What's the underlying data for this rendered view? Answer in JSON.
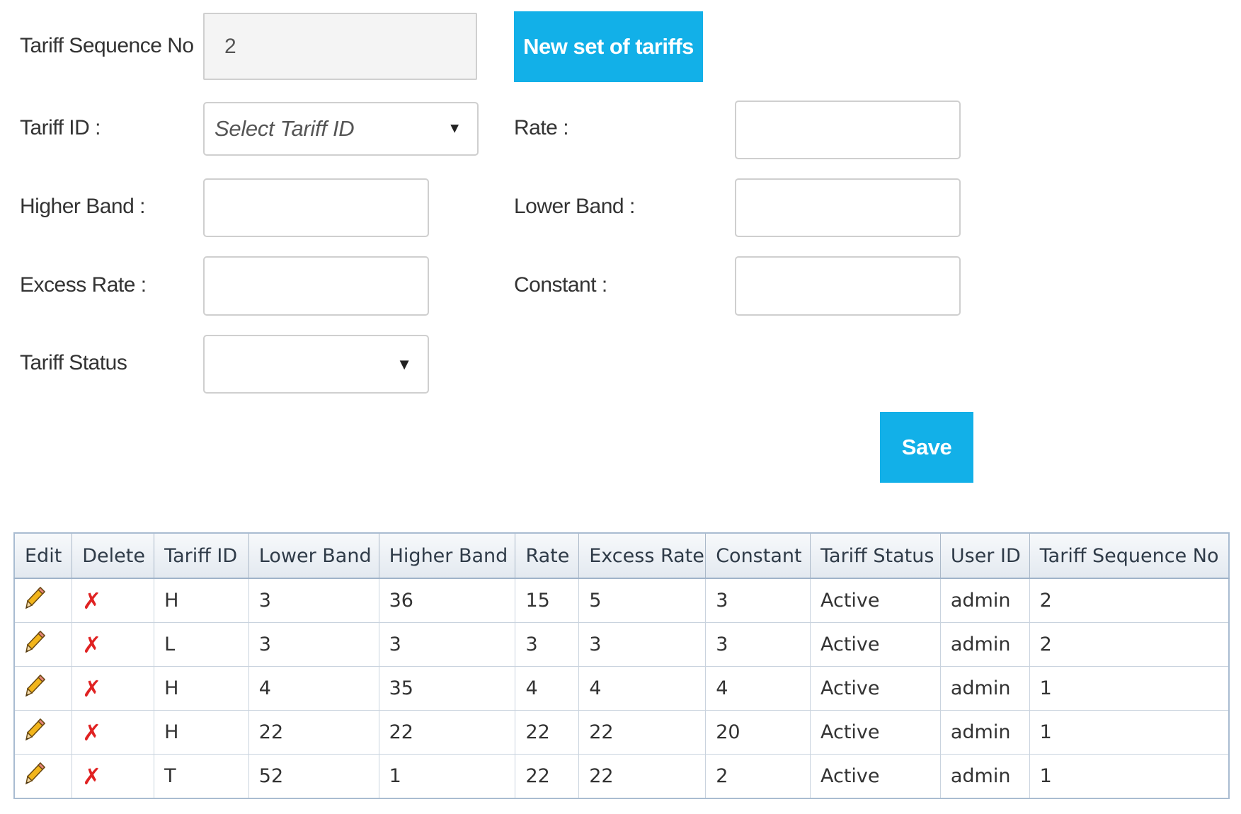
{
  "form": {
    "sequence_label": "Tariff Sequence No",
    "sequence_value": "2",
    "new_set_button": "New set of tariffs",
    "tariff_id_label": "Tariff ID :",
    "tariff_id_placeholder": "Select Tariff ID",
    "rate_label": "Rate :",
    "rate_value": "",
    "higher_band_label": "Higher Band :",
    "higher_band_value": "",
    "lower_band_label": "Lower Band :",
    "lower_band_value": "",
    "excess_rate_label": "Excess Rate :",
    "excess_rate_value": "",
    "constant_label": "Constant :",
    "constant_value": "",
    "status_label": "Tariff Status",
    "status_value": "",
    "save_button": "Save"
  },
  "table": {
    "columns": [
      "Edit",
      "Delete",
      "Tariff ID",
      "Lower Band",
      "Higher Band",
      "Rate",
      "Excess Rate",
      "Constant",
      "Tariff Status",
      "User ID",
      "Tariff Sequence No"
    ],
    "edit_icon": "pencil-icon",
    "delete_icon": "delete-x-icon",
    "delete_glyph": "✗",
    "delete_color": "#e02222",
    "rows": [
      {
        "tariff_id": "H",
        "lower_band": "3",
        "higher_band": "36",
        "rate": "15",
        "excess_rate": "5",
        "constant": "3",
        "status": "Active",
        "user_id": "admin",
        "sequence_no": "2"
      },
      {
        "tariff_id": "L",
        "lower_band": "3",
        "higher_band": "3",
        "rate": "3",
        "excess_rate": "3",
        "constant": "3",
        "status": "Active",
        "user_id": "admin",
        "sequence_no": "2"
      },
      {
        "tariff_id": "H",
        "lower_band": "4",
        "higher_band": "35",
        "rate": "4",
        "excess_rate": "4",
        "constant": "4",
        "status": "Active",
        "user_id": "admin",
        "sequence_no": "1"
      },
      {
        "tariff_id": "H",
        "lower_band": "22",
        "higher_band": "22",
        "rate": "22",
        "excess_rate": "22",
        "constant": "20",
        "status": "Active",
        "user_id": "admin",
        "sequence_no": "1"
      },
      {
        "tariff_id": "T",
        "lower_band": "52",
        "higher_band": "1",
        "rate": "22",
        "excess_rate": "22",
        "constant": "2",
        "status": "Active",
        "user_id": "admin",
        "sequence_no": "1"
      }
    ]
  },
  "colors": {
    "accent": "#12b0e8",
    "delete_red": "#e02222",
    "table_border": "#a9bcd1"
  }
}
